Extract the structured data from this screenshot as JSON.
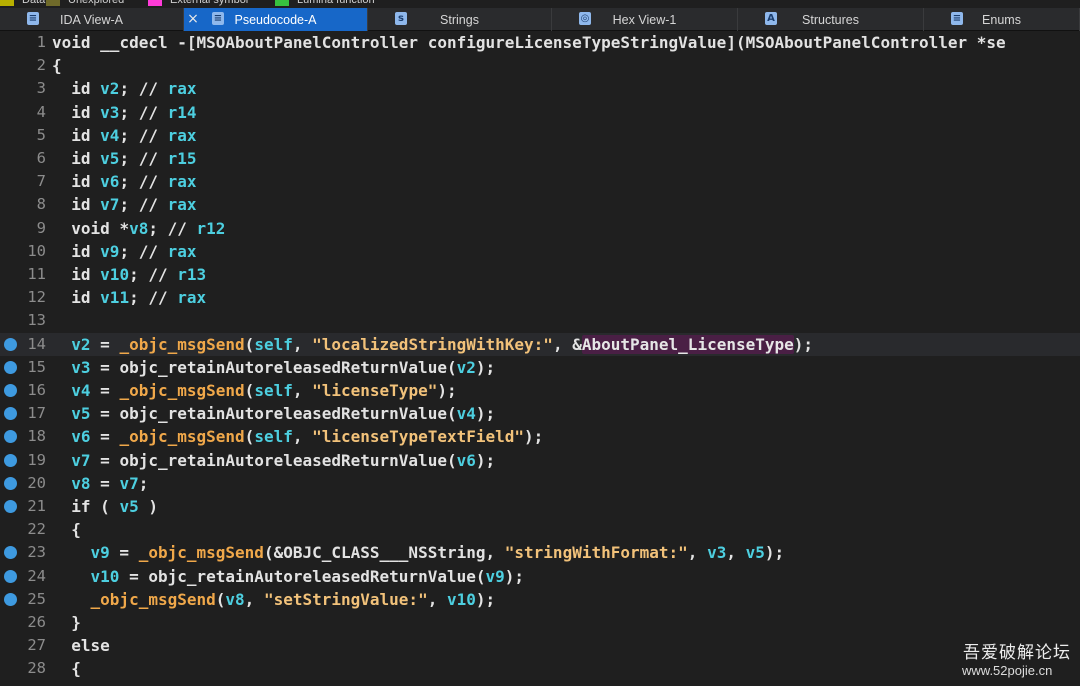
{
  "legend": [
    {
      "label": "Data",
      "color": "#b8b000"
    },
    {
      "label": "Unexplored",
      "color": "#6f6a2a"
    },
    {
      "label": "External symbol",
      "color": "#ff3bd8"
    },
    {
      "label": "Lumina function",
      "color": "#37c23f"
    }
  ],
  "tabs": [
    {
      "label": "IDA View-A",
      "icon": "ida-view-icon",
      "active": false
    },
    {
      "label": "Pseudocode-A",
      "icon": "pseudocode-icon",
      "active": true
    },
    {
      "label": "Strings",
      "icon": "strings-icon",
      "active": false
    },
    {
      "label": "Hex View-1",
      "icon": "hex-view-icon",
      "active": false
    },
    {
      "label": "Structures",
      "icon": "structures-icon",
      "active": false
    },
    {
      "label": "Enums",
      "icon": "enums-icon",
      "active": false
    }
  ],
  "lines": [
    {
      "num": "1",
      "bp": false,
      "hl": false,
      "tokens": [
        [
          "k",
          "void "
        ],
        [
          "k",
          "__cdecl "
        ],
        [
          "d",
          "-["
        ],
        [
          "n",
          "MSOAboutPanelController configureLicenseTypeStringValue"
        ],
        [
          "d",
          "]("
        ],
        [
          "n",
          "MSOAboutPanelController "
        ],
        [
          "d",
          "*"
        ],
        [
          "n",
          "se"
        ]
      ]
    },
    {
      "num": "2",
      "bp": false,
      "hl": false,
      "tokens": [
        [
          "d",
          "{"
        ]
      ]
    },
    {
      "num": "3",
      "bp": false,
      "hl": false,
      "tokens": [
        [
          "d",
          "  "
        ],
        [
          "k",
          "id "
        ],
        [
          "v",
          "v2"
        ],
        [
          "d",
          "; "
        ],
        [
          "c",
          "// "
        ],
        [
          "v",
          "rax"
        ]
      ]
    },
    {
      "num": "4",
      "bp": false,
      "hl": false,
      "tokens": [
        [
          "d",
          "  "
        ],
        [
          "k",
          "id "
        ],
        [
          "v",
          "v3"
        ],
        [
          "d",
          "; "
        ],
        [
          "c",
          "// "
        ],
        [
          "v",
          "r14"
        ]
      ]
    },
    {
      "num": "5",
      "bp": false,
      "hl": false,
      "tokens": [
        [
          "d",
          "  "
        ],
        [
          "k",
          "id "
        ],
        [
          "v",
          "v4"
        ],
        [
          "d",
          "; "
        ],
        [
          "c",
          "// "
        ],
        [
          "v",
          "rax"
        ]
      ]
    },
    {
      "num": "6",
      "bp": false,
      "hl": false,
      "tokens": [
        [
          "d",
          "  "
        ],
        [
          "k",
          "id "
        ],
        [
          "v",
          "v5"
        ],
        [
          "d",
          "; "
        ],
        [
          "c",
          "// "
        ],
        [
          "v",
          "r15"
        ]
      ]
    },
    {
      "num": "7",
      "bp": false,
      "hl": false,
      "tokens": [
        [
          "d",
          "  "
        ],
        [
          "k",
          "id "
        ],
        [
          "v",
          "v6"
        ],
        [
          "d",
          "; "
        ],
        [
          "c",
          "// "
        ],
        [
          "v",
          "rax"
        ]
      ]
    },
    {
      "num": "8",
      "bp": false,
      "hl": false,
      "tokens": [
        [
          "d",
          "  "
        ],
        [
          "k",
          "id "
        ],
        [
          "v",
          "v7"
        ],
        [
          "d",
          "; "
        ],
        [
          "c",
          "// "
        ],
        [
          "v",
          "rax"
        ]
      ]
    },
    {
      "num": "9",
      "bp": false,
      "hl": false,
      "tokens": [
        [
          "d",
          "  "
        ],
        [
          "k",
          "void "
        ],
        [
          "d",
          "*"
        ],
        [
          "v",
          "v8"
        ],
        [
          "d",
          "; "
        ],
        [
          "c",
          "// "
        ],
        [
          "v",
          "r12"
        ]
      ]
    },
    {
      "num": "10",
      "bp": false,
      "hl": false,
      "tokens": [
        [
          "d",
          "  "
        ],
        [
          "k",
          "id "
        ],
        [
          "v",
          "v9"
        ],
        [
          "d",
          "; "
        ],
        [
          "c",
          "// "
        ],
        [
          "v",
          "rax"
        ]
      ]
    },
    {
      "num": "11",
      "bp": false,
      "hl": false,
      "tokens": [
        [
          "d",
          "  "
        ],
        [
          "k",
          "id "
        ],
        [
          "v",
          "v10"
        ],
        [
          "d",
          "; "
        ],
        [
          "c",
          "// "
        ],
        [
          "v",
          "r13"
        ]
      ]
    },
    {
      "num": "12",
      "bp": false,
      "hl": false,
      "tokens": [
        [
          "d",
          "  "
        ],
        [
          "k",
          "id "
        ],
        [
          "v",
          "v11"
        ],
        [
          "d",
          "; "
        ],
        [
          "c",
          "// "
        ],
        [
          "v",
          "rax"
        ]
      ]
    },
    {
      "num": "13",
      "bp": false,
      "hl": false,
      "tokens": []
    },
    {
      "num": "14",
      "bp": true,
      "hl": true,
      "tokens": [
        [
          "d",
          "  "
        ],
        [
          "v",
          "v2"
        ],
        [
          "d",
          " = "
        ],
        [
          "f",
          "_objc_msgSend"
        ],
        [
          "d",
          "("
        ],
        [
          "v",
          "self"
        ],
        [
          "d",
          ", "
        ],
        [
          "s",
          "\"localizedStringWithKey:\""
        ],
        [
          "d",
          ", &"
        ],
        [
          "sym",
          "AboutPanel_LicenseType"
        ],
        [
          "d",
          ");"
        ]
      ]
    },
    {
      "num": "15",
      "bp": true,
      "hl": false,
      "tokens": [
        [
          "d",
          "  "
        ],
        [
          "v",
          "v3"
        ],
        [
          "d",
          " = "
        ],
        [
          "n",
          "objc_retainAutoreleasedReturnValue"
        ],
        [
          "d",
          "("
        ],
        [
          "v",
          "v2"
        ],
        [
          "d",
          ");"
        ]
      ]
    },
    {
      "num": "16",
      "bp": true,
      "hl": false,
      "tokens": [
        [
          "d",
          "  "
        ],
        [
          "v",
          "v4"
        ],
        [
          "d",
          " = "
        ],
        [
          "f",
          "_objc_msgSend"
        ],
        [
          "d",
          "("
        ],
        [
          "v",
          "self"
        ],
        [
          "d",
          ", "
        ],
        [
          "s",
          "\"licenseType\""
        ],
        [
          "d",
          ");"
        ]
      ]
    },
    {
      "num": "17",
      "bp": true,
      "hl": false,
      "tokens": [
        [
          "d",
          "  "
        ],
        [
          "v",
          "v5"
        ],
        [
          "d",
          " = "
        ],
        [
          "n",
          "objc_retainAutoreleasedReturnValue"
        ],
        [
          "d",
          "("
        ],
        [
          "v",
          "v4"
        ],
        [
          "d",
          ");"
        ]
      ]
    },
    {
      "num": "18",
      "bp": true,
      "hl": false,
      "tokens": [
        [
          "d",
          "  "
        ],
        [
          "v",
          "v6"
        ],
        [
          "d",
          " = "
        ],
        [
          "f",
          "_objc_msgSend"
        ],
        [
          "d",
          "("
        ],
        [
          "v",
          "self"
        ],
        [
          "d",
          ", "
        ],
        [
          "s",
          "\"licenseTypeTextField\""
        ],
        [
          "d",
          ");"
        ]
      ]
    },
    {
      "num": "19",
      "bp": true,
      "hl": false,
      "tokens": [
        [
          "d",
          "  "
        ],
        [
          "v",
          "v7"
        ],
        [
          "d",
          " = "
        ],
        [
          "n",
          "objc_retainAutoreleasedReturnValue"
        ],
        [
          "d",
          "("
        ],
        [
          "v",
          "v6"
        ],
        [
          "d",
          ");"
        ]
      ]
    },
    {
      "num": "20",
      "bp": true,
      "hl": false,
      "tokens": [
        [
          "d",
          "  "
        ],
        [
          "v",
          "v8"
        ],
        [
          "d",
          " = "
        ],
        [
          "v",
          "v7"
        ],
        [
          "d",
          ";"
        ]
      ]
    },
    {
      "num": "21",
      "bp": true,
      "hl": false,
      "tokens": [
        [
          "d",
          "  "
        ],
        [
          "k",
          "if"
        ],
        [
          "d",
          " ( "
        ],
        [
          "v",
          "v5"
        ],
        [
          "d",
          " )"
        ]
      ]
    },
    {
      "num": "22",
      "bp": false,
      "hl": false,
      "tokens": [
        [
          "d",
          "  {"
        ]
      ]
    },
    {
      "num": "23",
      "bp": true,
      "hl": false,
      "tokens": [
        [
          "d",
          "    "
        ],
        [
          "v",
          "v9"
        ],
        [
          "d",
          " = "
        ],
        [
          "f",
          "_objc_msgSend"
        ],
        [
          "d",
          "(&"
        ],
        [
          "n",
          "OBJC_CLASS___NSString"
        ],
        [
          "d",
          ", "
        ],
        [
          "s",
          "\"stringWithFormat:\""
        ],
        [
          "d",
          ", "
        ],
        [
          "v",
          "v3"
        ],
        [
          "d",
          ", "
        ],
        [
          "v",
          "v5"
        ],
        [
          "d",
          ");"
        ]
      ]
    },
    {
      "num": "24",
      "bp": true,
      "hl": false,
      "tokens": [
        [
          "d",
          "    "
        ],
        [
          "v",
          "v10"
        ],
        [
          "d",
          " = "
        ],
        [
          "n",
          "objc_retainAutoreleasedReturnValue"
        ],
        [
          "d",
          "("
        ],
        [
          "v",
          "v9"
        ],
        [
          "d",
          ");"
        ]
      ]
    },
    {
      "num": "25",
      "bp": true,
      "hl": false,
      "tokens": [
        [
          "d",
          "    "
        ],
        [
          "f",
          "_objc_msgSend"
        ],
        [
          "d",
          "("
        ],
        [
          "v",
          "v8"
        ],
        [
          "d",
          ", "
        ],
        [
          "s",
          "\"setStringValue:\""
        ],
        [
          "d",
          ", "
        ],
        [
          "v",
          "v10"
        ],
        [
          "d",
          ");"
        ]
      ]
    },
    {
      "num": "26",
      "bp": false,
      "hl": false,
      "tokens": [
        [
          "d",
          "  }"
        ]
      ]
    },
    {
      "num": "27",
      "bp": false,
      "hl": false,
      "tokens": [
        [
          "d",
          "  "
        ],
        [
          "k",
          "else"
        ]
      ]
    },
    {
      "num": "28",
      "bp": false,
      "hl": false,
      "tokens": [
        [
          "d",
          "  {"
        ]
      ]
    }
  ],
  "watermark": {
    "title": "吾爱破解论坛",
    "url": "www.52pojie.cn"
  }
}
